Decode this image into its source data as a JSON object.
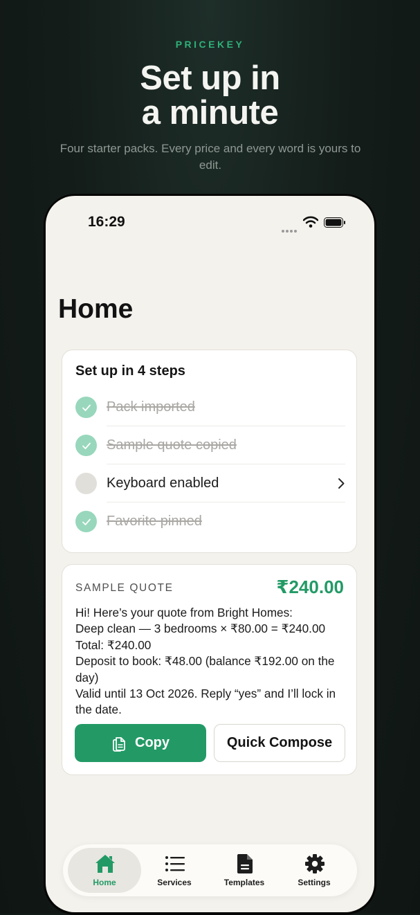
{
  "hero": {
    "brand": "PRICEKEY",
    "title_line1": "Set up in",
    "title_line2": "a minute",
    "subtitle": "Four starter packs. Every price and every word is yours to edit."
  },
  "status_bar": {
    "time": "16:29"
  },
  "page_title": "Home",
  "setup": {
    "title": "Set up in 4 steps",
    "steps": [
      {
        "label": "Pack imported",
        "done": true
      },
      {
        "label": "Sample quote copied",
        "done": true
      },
      {
        "label": "Keyboard enabled",
        "done": false
      },
      {
        "label": "Favorite pinned",
        "done": true
      }
    ]
  },
  "quote": {
    "label": "SAMPLE QUOTE",
    "amount": "₹240.00",
    "lines": [
      "Hi! Here’s your quote from Bright Homes:",
      "Deep clean — 3 bedrooms × ₹80.00 = ₹240.00",
      "Total: ₹240.00",
      "Deposit to book: ₹48.00 (balance ₹192.00 on the day)",
      "Valid until 13 Oct 2026. Reply “yes” and I’ll lock in the date."
    ],
    "copy_label": "Copy",
    "compose_label": "Quick Compose"
  },
  "tabs": [
    {
      "label": "Home",
      "icon": "home-icon",
      "selected": true
    },
    {
      "label": "Services",
      "icon": "list-icon",
      "selected": false
    },
    {
      "label": "Templates",
      "icon": "document-icon",
      "selected": false
    },
    {
      "label": "Settings",
      "icon": "gear-icon",
      "selected": false
    }
  ],
  "colors": {
    "accent": "#239a66",
    "brand": "#2fb079",
    "background": "#f4f2ed"
  }
}
